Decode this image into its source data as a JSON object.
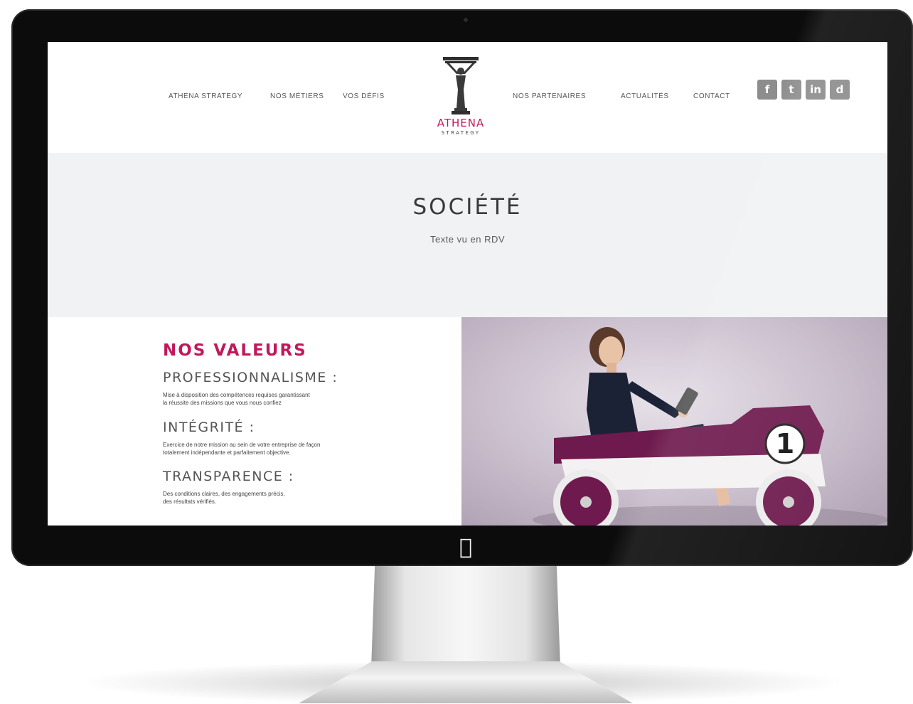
{
  "nav": {
    "left": [
      "ATHENA STRATEGY",
      "NOS MÉTIERS",
      "VOS DÉFIS"
    ],
    "right": [
      "NOS PARTENAIRES",
      "ACTUALITÉS",
      "CONTACT"
    ]
  },
  "logo": {
    "word": "ATHENA",
    "sub": "STRATEGY",
    "accent": "#c2185b"
  },
  "social": [
    {
      "icon": "facebook-icon",
      "glyph": "f"
    },
    {
      "icon": "twitter-icon",
      "glyph": "t"
    },
    {
      "icon": "linkedin-icon",
      "glyph": "in"
    },
    {
      "icon": "viadeo-icon",
      "glyph": "d"
    }
  ],
  "hero": {
    "title": "SOCIÉTÉ",
    "subtitle": "Texte vu en RDV"
  },
  "values": {
    "title": "NOS VALEURS",
    "items": [
      {
        "heading": "PROFESSIONNALISME :",
        "line1": "Mise à disposition des compétences requises garantissant",
        "line2": "la réussite des missions que vous nous confiez"
      },
      {
        "heading": "INTÉGRITÉ :",
        "line1": "Exercice de notre mission au sein de votre entreprise de façon",
        "line2": "totalement indépendante et parfaitement objective."
      },
      {
        "heading": "TRANSPARENCE :",
        "line1": "Des conditions claires, des engagements précis,",
        "line2": "des résultats vérifiés."
      }
    ]
  },
  "photo": {
    "car_number": "1"
  },
  "colors": {
    "accent": "#c2185b",
    "car": "#6e1a4e",
    "bezel": "#0c0c0c"
  }
}
